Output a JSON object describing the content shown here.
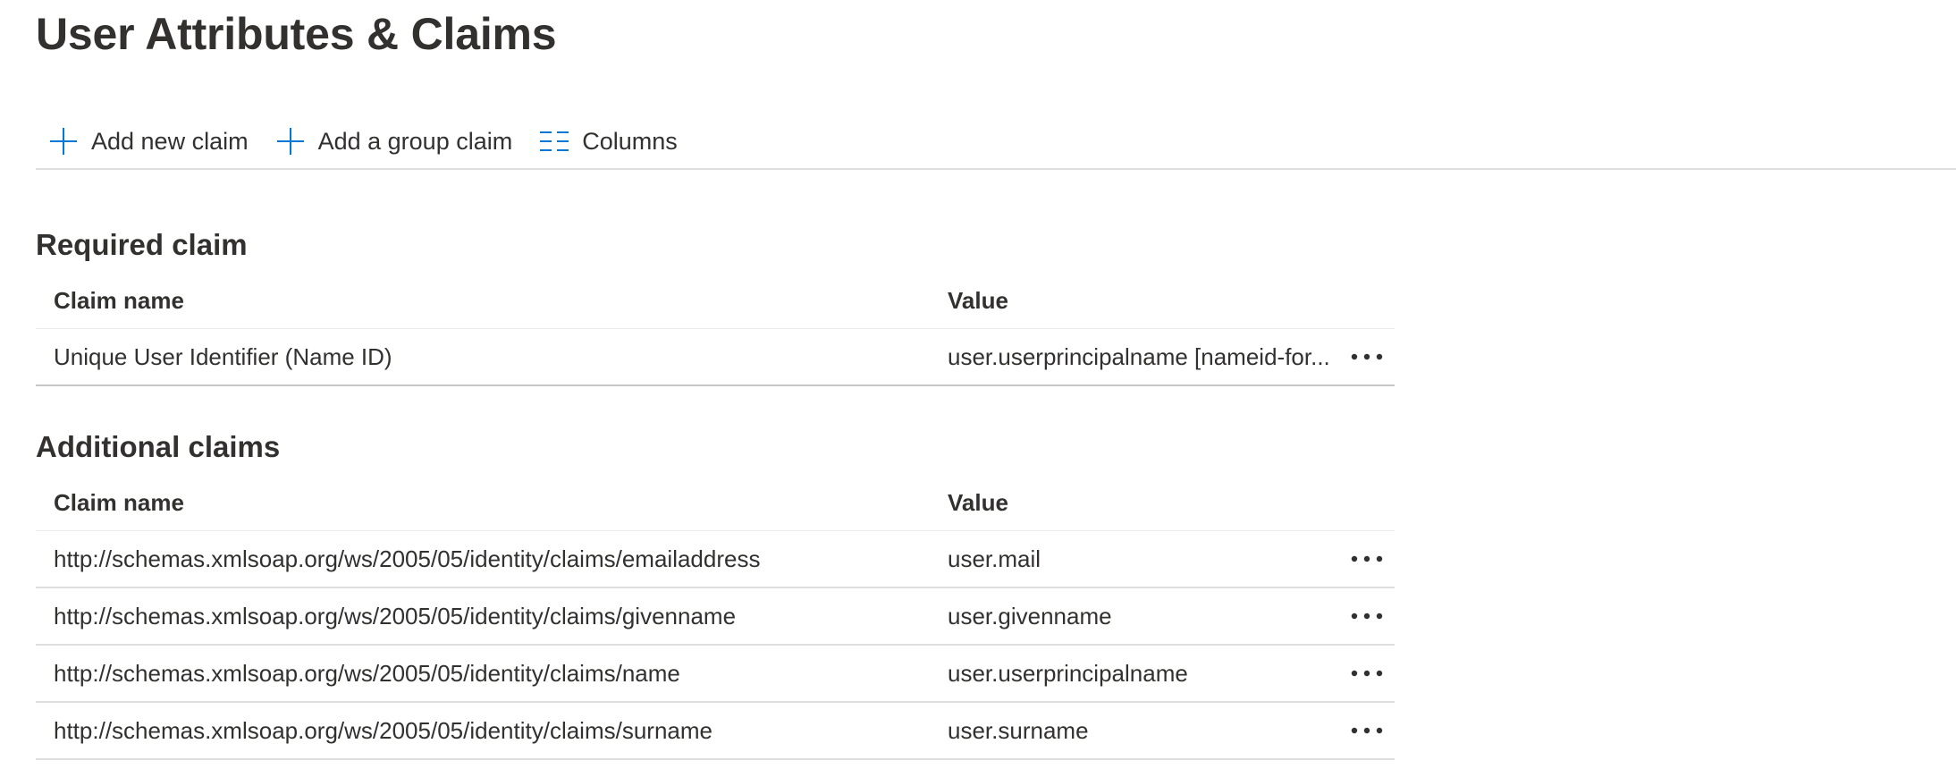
{
  "page": {
    "title": "User Attributes & Claims"
  },
  "toolbar": {
    "add_claim_label": "Add new claim",
    "add_group_claim_label": "Add a group claim",
    "columns_label": "Columns"
  },
  "required": {
    "section_title": "Required claim",
    "headers": {
      "name": "Claim name",
      "value": "Value"
    },
    "rows": [
      {
        "name": "Unique User Identifier (Name ID)",
        "value": "user.userprincipalname [nameid-for..."
      }
    ]
  },
  "additional": {
    "section_title": "Additional claims",
    "headers": {
      "name": "Claim name",
      "value": "Value"
    },
    "rows": [
      {
        "name": "http://schemas.xmlsoap.org/ws/2005/05/identity/claims/emailaddress",
        "value": "user.mail"
      },
      {
        "name": "http://schemas.xmlsoap.org/ws/2005/05/identity/claims/givenname",
        "value": "user.givenname"
      },
      {
        "name": "http://schemas.xmlsoap.org/ws/2005/05/identity/claims/name",
        "value": "user.userprincipalname"
      },
      {
        "name": "http://schemas.xmlsoap.org/ws/2005/05/identity/claims/surname",
        "value": "user.surname"
      }
    ]
  },
  "colors": {
    "accent": "#0078d4",
    "text": "#323130",
    "divider": "#e1dfdd"
  },
  "icons": {
    "add": "plus-icon",
    "columns": "columns-icon",
    "more": "more-options-icon"
  }
}
